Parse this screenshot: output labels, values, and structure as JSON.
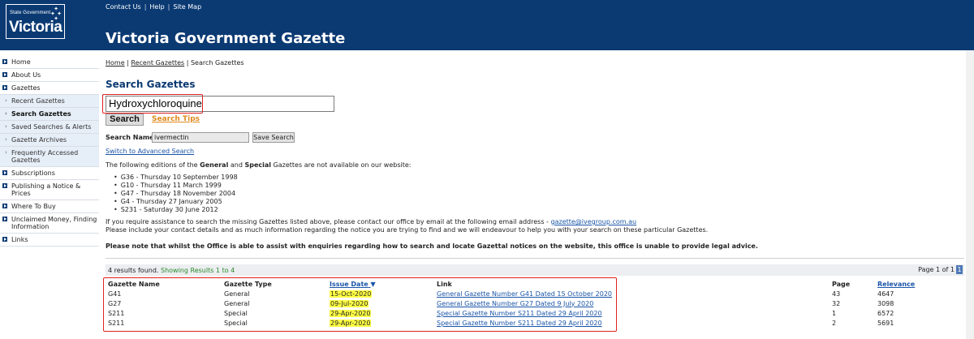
{
  "header": {
    "logo_small": "State Government",
    "logo_big": "Victoria",
    "top_links": [
      "Contact Us",
      "Help",
      "Site Map"
    ],
    "title": "Victoria Government Gazette"
  },
  "sidebar": {
    "items": [
      {
        "label": "Home",
        "type": "main"
      },
      {
        "label": "About Us",
        "type": "main"
      },
      {
        "label": "Gazettes",
        "type": "main"
      },
      {
        "label": "Recent Gazettes",
        "type": "sub"
      },
      {
        "label": "Search Gazettes",
        "type": "sub-active"
      },
      {
        "label": "Saved Searches & Alerts",
        "type": "sub"
      },
      {
        "label": "Gazette Archives",
        "type": "sub"
      },
      {
        "label": "Frequently Accessed Gazettes",
        "type": "sub"
      },
      {
        "label": "Subscriptions",
        "type": "main"
      },
      {
        "label": "Publishing a Notice & Prices",
        "type": "main"
      },
      {
        "label": "Where To Buy",
        "type": "main"
      },
      {
        "label": "Unclaimed Money, Finding Information",
        "type": "main"
      },
      {
        "label": "Links",
        "type": "main"
      }
    ]
  },
  "breadcrumb": {
    "home": "Home",
    "recent": "Recent Gazettes",
    "current": "Search Gazettes"
  },
  "page_title": "Search Gazettes",
  "search": {
    "query": "Hydroxychloroquine",
    "button": "Search",
    "tips": "Search Tips",
    "name_label": "Search Name:",
    "name_value": "ivermectin",
    "save_button": "Save Search",
    "advanced_link": "Switch to Advanced Search"
  },
  "notice": {
    "intro_pre": "The following editions of the ",
    "intro_b1": "General",
    "intro_mid": " and ",
    "intro_b2": "Special",
    "intro_post": " Gazettes are not available on our website:",
    "missing": [
      "G36 - Thursday 10 September 1998",
      "G10 - Thursday 11 March 1999",
      "G47 - Thursday 18 November 2004",
      "G4 - Thursday 27 January 2005",
      "S231 - Saturday 30 June 2012"
    ],
    "assist_pre": "If you require assistance to search the missing Gazettes listed above, please contact our office by email at the following email address - ",
    "assist_email": "gazette@ivegroup.com.au",
    "assist_line2": "Please include your contact details and as much information regarding the notice you are trying to find and we will endeavour to help you with your search on these particular Gazettes.",
    "legal": "Please note that whilst the Office is able to assist with enquiries regarding how to search and locate Gazettal notices on the website, this office is unable to provide legal advice."
  },
  "results": {
    "found_text": "4 results found.",
    "showing_text": "Showing Results 1 to 4",
    "page_text": "Page 1 of 1",
    "page_number": "1",
    "columns": [
      "Gazette Name",
      "Gazette Type",
      "Issue Date",
      "Link",
      "Page",
      "Relevance"
    ],
    "rows": [
      {
        "name": "G41",
        "type": "General",
        "date": "15-Oct-2020",
        "link": "General Gazette Number G41 Dated 15 October 2020",
        "page": "43",
        "relevance": "4647"
      },
      {
        "name": "G27",
        "type": "General",
        "date": "09-Jul-2020",
        "link": "General Gazette Number G27 Dated 9 July 2020",
        "page": "32",
        "relevance": "3098"
      },
      {
        "name": "S211",
        "type": "Special",
        "date": "29-Apr-2020",
        "link": "Special Gazette Number S211 Dated 29 April 2020",
        "page": "1",
        "relevance": "6572"
      },
      {
        "name": "S211",
        "type": "Special",
        "date": "29-Apr-2020",
        "link": "Special Gazette Number S211 Dated 29 April 2020",
        "page": "2",
        "relevance": "5691"
      }
    ]
  },
  "colors": {
    "header_bg": "#0b3a73",
    "highlight_red": "#e02020",
    "date_yellow": "#ffff44",
    "link_blue": "#1a55a8",
    "tips_orange": "#e08a1e"
  }
}
